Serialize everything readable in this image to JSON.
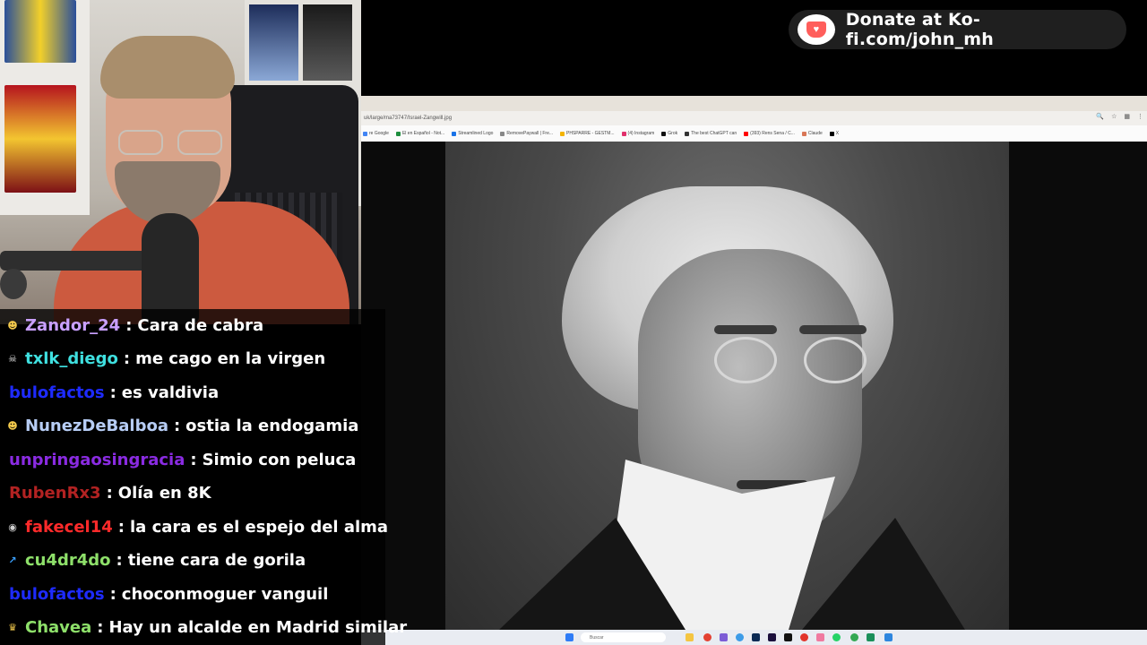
{
  "banner": {
    "text": "Donate at Ko-fi.com/john_mh",
    "icon": "kofi-cup-icon",
    "accent": "#ff5e5b"
  },
  "browser": {
    "url": "uk/large/ma73747/Israel-Zangwill.jpg",
    "bookmarks": [
      {
        "label": "re Google",
        "color": "#4285f4"
      },
      {
        "label": "El en Español - Not...",
        "color": "#1e8e3e"
      },
      {
        "label": "Streamlined Logo",
        "color": "#1a73e8"
      },
      {
        "label": "RemovePaywall | Fre...",
        "color": "#888888"
      },
      {
        "label": "PHSPARRE - GESTM...",
        "color": "#f4b400"
      },
      {
        "label": "(4) Instagram",
        "color": "#e1306c"
      },
      {
        "label": "Grok",
        "color": "#111111"
      },
      {
        "label": "The best ChatGPT can",
        "color": "#333333"
      },
      {
        "label": "(393) Rens Sena / C...",
        "color": "#ff0000"
      },
      {
        "label": "Claude",
        "color": "#d97757"
      },
      {
        "label": "X",
        "color": "#000000"
      }
    ],
    "taskbar_search": "Buscar"
  },
  "chat": [
    {
      "user": "Zandor_24",
      "color": "#c9a0ff",
      "badge": "sun-badge-icon",
      "badge_color": "#f2c94c",
      "text": "Cara de cabra"
    },
    {
      "user": "txlk_diego",
      "color": "#3fe0e0",
      "badge": "skull-badge-icon",
      "badge_color": "#e0e0e0",
      "text": "me cago en la virgen"
    },
    {
      "user": "bulofactos",
      "color": "#1e2bff",
      "badge": "",
      "badge_color": "",
      "text": "es valdivia"
    },
    {
      "user": "NunezDeBalboa",
      "color": "#b7cdf5",
      "badge": "sun-badge-icon",
      "badge_color": "#f2c94c",
      "text": "ostia la endogamia"
    },
    {
      "user": "unpringaosingracia",
      "color": "#8a2be2",
      "badge": "",
      "badge_color": "",
      "text": "Simio con peluca"
    },
    {
      "user": "RubenRx3",
      "color": "#b22222",
      "badge": "",
      "badge_color": "",
      "text": "Olía en 8K"
    },
    {
      "user": "fakecel14",
      "color": "#ff2a2a",
      "badge": "mask-badge-icon",
      "badge_color": "#d0d0d0",
      "text": "la cara es el espejo del alma"
    },
    {
      "user": "cu4dr4do",
      "color": "#8ee06a",
      "badge": "arrow-badge-icon",
      "badge_color": "#3aa0ff",
      "text": "tiene cara de gorila"
    },
    {
      "user": "bulofactos",
      "color": "#1e2bff",
      "badge": "",
      "badge_color": "",
      "text": "choconmoguer vanguil"
    },
    {
      "user": "Chavea",
      "color": "#8ee06a",
      "badge": "crown-badge-icon",
      "badge_color": "#f2c94c",
      "text": "Hay un alcalde en Madrid similar"
    }
  ]
}
